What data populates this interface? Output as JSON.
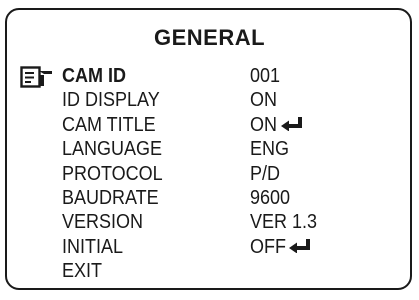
{
  "menu": {
    "title": "GENERAL",
    "selected_index": 0,
    "items": [
      {
        "label": "CAM ID",
        "value": "001",
        "submenu": false
      },
      {
        "label": "ID DISPLAY",
        "value": "ON",
        "submenu": false
      },
      {
        "label": "CAM TITLE",
        "value": "ON",
        "submenu": true
      },
      {
        "label": "LANGUAGE",
        "value": "ENG",
        "submenu": false
      },
      {
        "label": "PROTOCOL",
        "value": "P/D",
        "submenu": false
      },
      {
        "label": "BAUDRATE",
        "value": "9600",
        "submenu": false
      },
      {
        "label": "VERSION",
        "value": "VER 1.3",
        "submenu": false
      },
      {
        "label": "INITIAL",
        "value": "OFF",
        "submenu": true
      },
      {
        "label": "EXIT",
        "value": "",
        "submenu": false
      }
    ]
  },
  "icons": {
    "cursor": "pointing-hand-cursor-icon",
    "submenu": "enter-arrow-icon"
  },
  "colors": {
    "foreground": "#1a1a1a",
    "background": "#ffffff"
  }
}
